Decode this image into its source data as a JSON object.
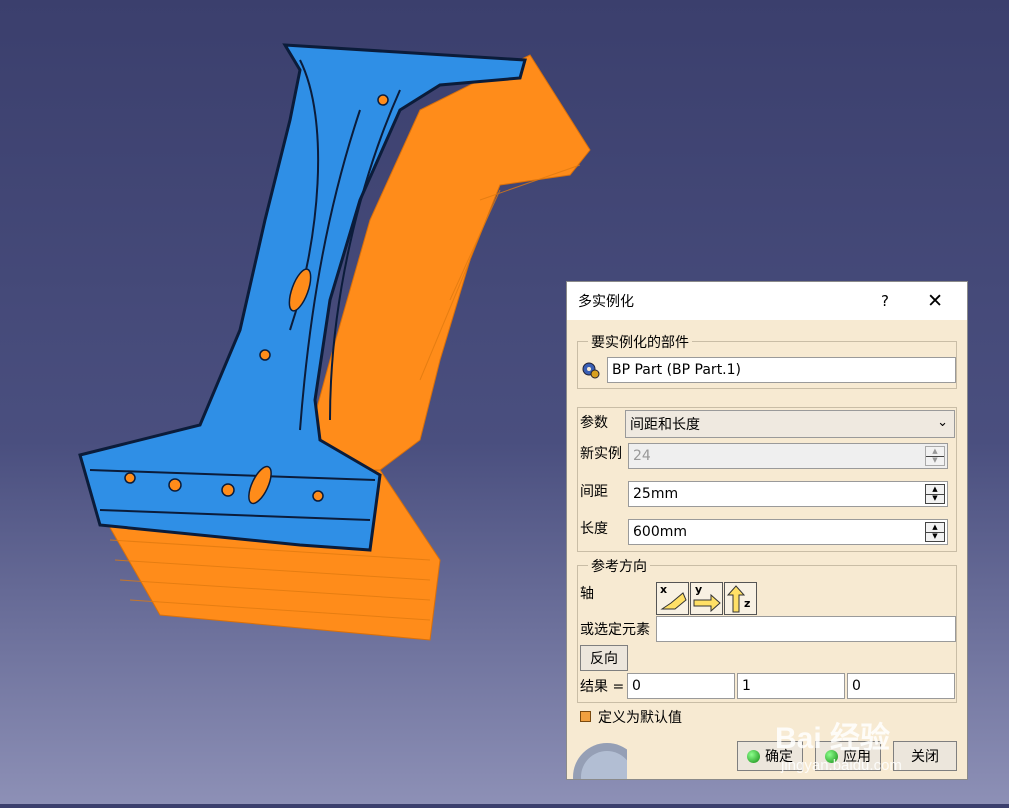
{
  "dialog": {
    "title": "多实例化",
    "help_label": "?",
    "close_label": "✕",
    "instance_group": {
      "legend": "要实例化的部件",
      "part_value": "BP Part (BP Part.1)"
    },
    "params": {
      "label": "参数",
      "mode_value": "间距和长度",
      "new_instances_label": "新实例",
      "new_instances_value": "24",
      "spacing_label": "间距",
      "spacing_value": "25mm",
      "length_label": "长度",
      "length_value": "600mm"
    },
    "reference": {
      "legend": "参考方向",
      "axis_label": "轴",
      "axis_buttons": [
        "x",
        "y",
        "z"
      ],
      "or_select_label": "或选定元素",
      "or_select_value": "",
      "reverse_label": "反向",
      "result_label": "结果 =",
      "result_values": [
        "0",
        "1",
        "0"
      ]
    },
    "default_checkbox_label": "定义为默认值",
    "buttons": {
      "ok": "确定",
      "apply": "应用",
      "close": "关闭"
    }
  },
  "watermark": {
    "brand": "Bai 经验",
    "url": "jingyan.baidu.com"
  }
}
